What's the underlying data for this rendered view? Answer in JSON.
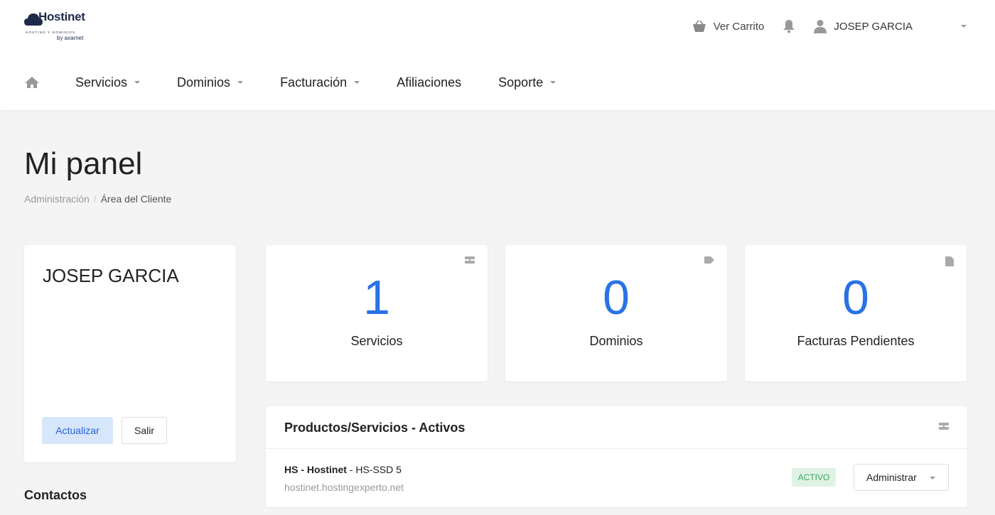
{
  "brand": {
    "logo_text": "Hostinet",
    "logo_tagline": "HOSTING Y DOMINIOS",
    "logo_by": "by axarnet"
  },
  "header": {
    "cart_label": "Ver Carrito",
    "user_name": "JOSEP GARCIA",
    "icons": {
      "cart": "basket-icon",
      "notifications": "bell-icon",
      "user": "person-icon"
    }
  },
  "nav": {
    "home_icon": "home-icon",
    "items": [
      {
        "label": "Servicios",
        "has_dropdown": true
      },
      {
        "label": "Dominios",
        "has_dropdown": true
      },
      {
        "label": "Facturación",
        "has_dropdown": true
      },
      {
        "label": "Afiliaciones",
        "has_dropdown": false
      },
      {
        "label": "Soporte",
        "has_dropdown": true
      }
    ]
  },
  "page": {
    "title": "Mi panel",
    "breadcrumb": [
      "Administración",
      "Área del Cliente"
    ]
  },
  "user_card": {
    "name": "JOSEP GARCIA",
    "update_label": "Actualizar",
    "logout_label": "Salir"
  },
  "contacts_heading": "Contactos",
  "stats": [
    {
      "value": "1",
      "label": "Servicios",
      "icon": "server-icon"
    },
    {
      "value": "0",
      "label": "Dominios",
      "icon": "tag-icon"
    },
    {
      "value": "0",
      "label": "Facturas Pendientes",
      "icon": "document-icon"
    }
  ],
  "products_panel": {
    "title": "Productos/Servicios - Activos",
    "icon": "server-icon",
    "rows": [
      {
        "group": "HS - Hostinet",
        "product": " - HS-SSD 5",
        "domain": "hostinet.hostingexperto.net",
        "status": "ACTIVO",
        "action_label": "Administrar"
      }
    ]
  },
  "colors": {
    "accent": "#2a72e5",
    "status_active_bg": "#dff3e4",
    "status_active_text": "#3aa55c",
    "background": "#f4f4f5"
  }
}
